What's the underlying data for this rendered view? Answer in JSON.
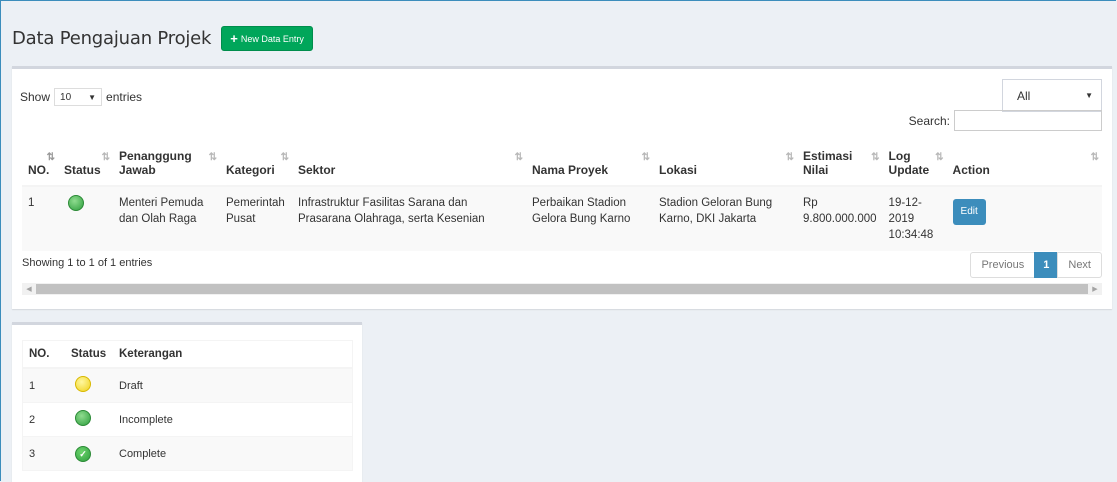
{
  "page": {
    "title": "Data Pengajuan Projek",
    "new_button": "New Data Entry"
  },
  "controls": {
    "show_label": "Show",
    "length_value": "10",
    "entries_label": "entries",
    "filter_value": "All",
    "search_label": "Search:"
  },
  "table": {
    "columns": [
      "NO.",
      "Status",
      "Penanggung Jawab",
      "Kategori",
      "Sektor",
      "Nama Proyek",
      "Lokasi",
      "Estimasi Nilai",
      "Log Update",
      "Action"
    ],
    "rows": [
      {
        "no": "1",
        "status": "incomplete",
        "penanggung_jawab": "Menteri Pemuda dan Olah Raga",
        "kategori": "Pemerintah Pusat",
        "sektor": "Infrastruktur Fasilitas Sarana dan Prasarana Olahraga, serta Kesenian",
        "nama_proyek": "Perbaikan Stadion Gelora Bung Karno",
        "lokasi": "Stadion Geloran Bung Karno, DKI Jakarta",
        "estimasi_nilai": "Rp 9.800.000.000",
        "log_update": "19-12-2019 10:34:48",
        "action": "Edit"
      }
    ],
    "info": "Showing 1 to 1 of 1 entries"
  },
  "pagination": {
    "previous": "Previous",
    "current": "1",
    "next": "Next"
  },
  "legend": {
    "columns": [
      "NO.",
      "Status",
      "Keterangan"
    ],
    "rows": [
      {
        "no": "1",
        "status": "yellow",
        "keterangan": "Draft"
      },
      {
        "no": "2",
        "status": "green",
        "keterangan": "Incomplete"
      },
      {
        "no": "3",
        "status": "check",
        "keterangan": "Complete"
      }
    ]
  },
  "colors": {
    "accent": "#3c8dbc",
    "success": "#00a65a"
  }
}
